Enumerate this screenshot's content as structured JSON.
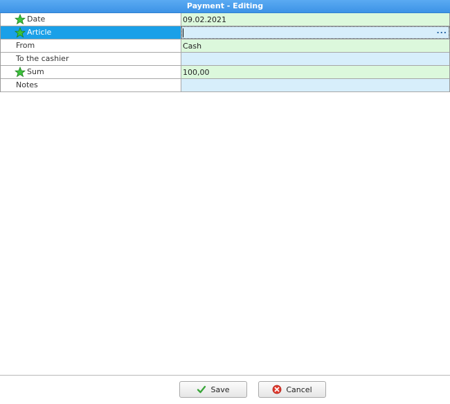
{
  "window": {
    "title": "Payment - Editing"
  },
  "fields": [
    {
      "label": "Date",
      "value": "09.02.2021",
      "required": true,
      "icon": "green-star-icon",
      "value_bg": "green"
    },
    {
      "label": "Article",
      "value": "",
      "required": true,
      "icon": "green-star-icon",
      "value_bg": "blue",
      "selected": true,
      "editor_button": "..."
    },
    {
      "label": "From",
      "value": "Cash",
      "required": false,
      "value_bg": "green"
    },
    {
      "label": "To the cashier",
      "value": "",
      "required": false,
      "value_bg": "blue"
    },
    {
      "label": "Sum",
      "value": "100,00",
      "required": true,
      "icon": "green-star-icon",
      "value_bg": "green"
    },
    {
      "label": "Notes",
      "value": "",
      "required": false,
      "value_bg": "blue"
    }
  ],
  "buttons": {
    "save_label": "Save",
    "save_icon": "green-check-icon",
    "cancel_label": "Cancel",
    "cancel_icon": "red-cancel-icon"
  },
  "colors": {
    "title_bar": "#3d93e6",
    "selected_row": "#1aa0e8",
    "value_green": "#dcf8dc",
    "value_blue": "#d7eefb"
  }
}
